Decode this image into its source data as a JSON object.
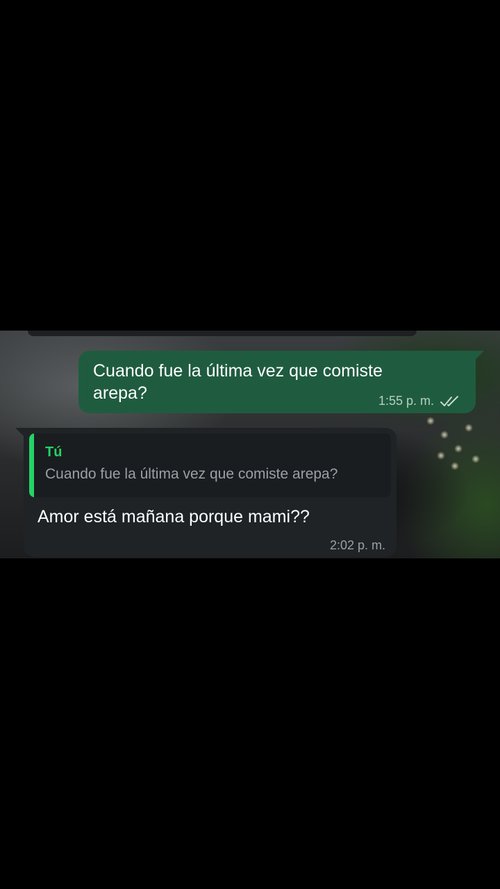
{
  "conversation": {
    "outgoing_message": {
      "text": "Cuando fue la última vez que comiste arepa?",
      "time": "1:55 p. m.",
      "status_icon": "double-check-icon",
      "bubble_color": "#1f5c3f"
    },
    "incoming_message": {
      "quoted_author": "Tú",
      "quoted_text": "Cuando fue la última vez que comiste arepa?",
      "text": "Amor está mañana porque mami??",
      "time": "2:02 p. m.",
      "bubble_color": "#1f2326",
      "quote_accent_color": "#25d366"
    }
  }
}
